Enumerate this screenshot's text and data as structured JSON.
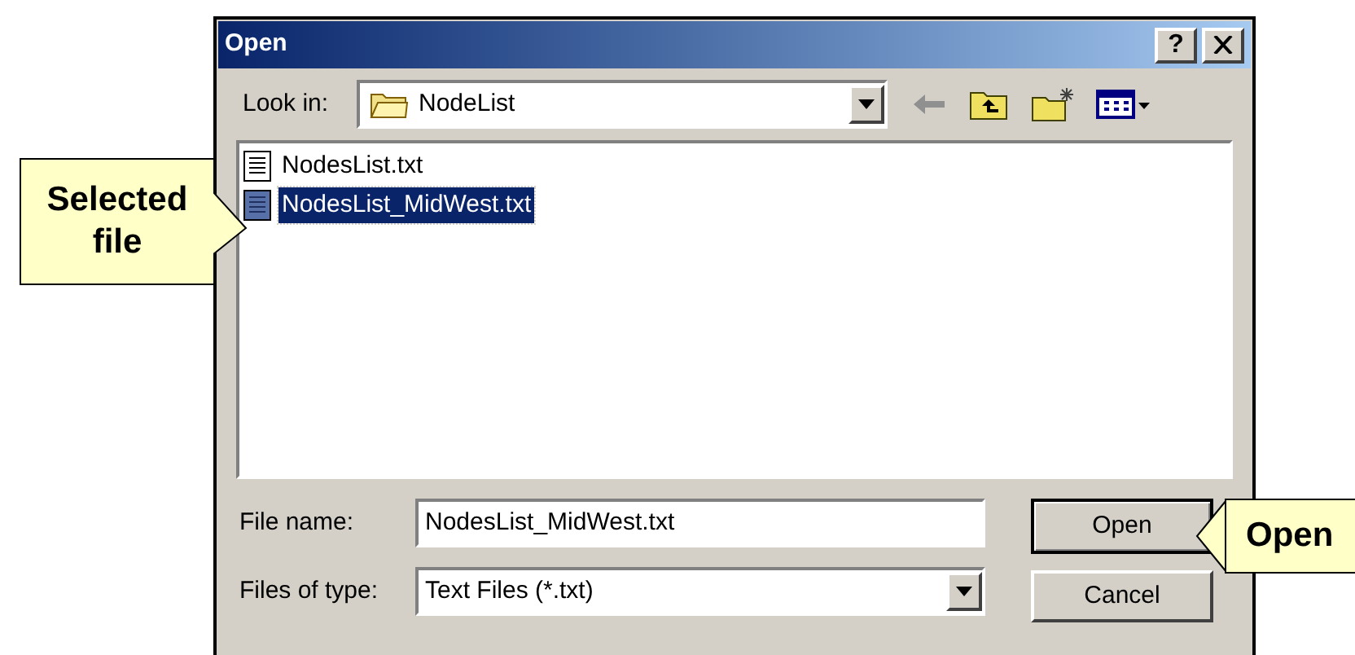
{
  "window": {
    "title": "Open",
    "help_button": "?"
  },
  "look_in": {
    "label": "Look in:",
    "value": "NodeList"
  },
  "files": [
    {
      "name": "NodesList.txt",
      "selected": false
    },
    {
      "name": "NodesList_MidWest.txt",
      "selected": true
    }
  ],
  "file_name": {
    "label": "File name:",
    "value": "NodesList_MidWest.txt"
  },
  "file_type": {
    "label": "Files of type:",
    "value": "Text Files (*.txt)"
  },
  "buttons": [
    {
      "label": "Open",
      "default": true
    },
    {
      "label": "Cancel",
      "default": false
    }
  ],
  "callouts": [
    {
      "text": "Selected file"
    },
    {
      "text": "Open"
    }
  ]
}
